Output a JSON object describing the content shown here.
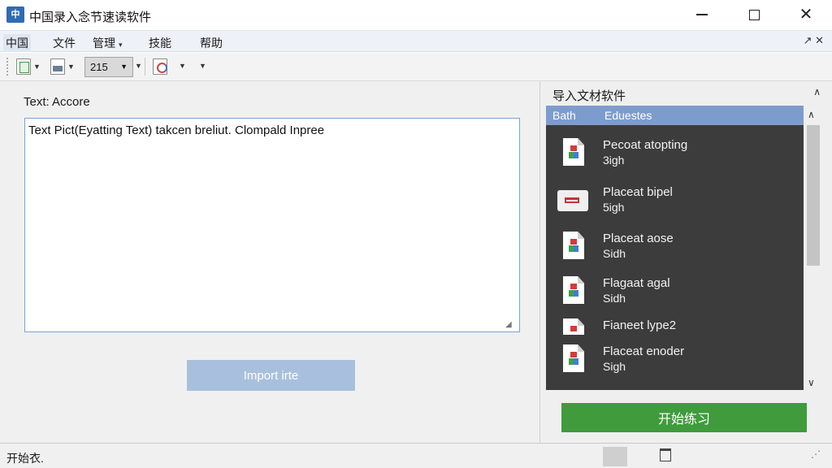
{
  "window": {
    "icon_text": "中",
    "title": "中国录入念节速读软件"
  },
  "menubar": {
    "items": [
      {
        "label": "中国"
      },
      {
        "label": "文件"
      },
      {
        "label": "管理",
        "caret": "▾"
      },
      {
        "label": "技能"
      },
      {
        "label": "帮助"
      }
    ],
    "right_symbols": "↗ ✕"
  },
  "toolbar": {
    "combo_value": "215"
  },
  "editor": {
    "label": "Text:  Accore",
    "content": "Text Pict(Eyatting Text) takcen breliut. Clompald Inpree",
    "import_button": "Import irte"
  },
  "right_panel": {
    "header": "导入文材软件",
    "columns": [
      "Bath",
      "Eduestes"
    ],
    "items": [
      {
        "title": "Pecoat atopting",
        "sub": "3igh",
        "icon": "document-icon"
      },
      {
        "title": "Placeat bipel",
        "sub": "5igh",
        "icon": "folder-icon"
      },
      {
        "title": "Placeat aose",
        "sub": "Sidh",
        "icon": "document-icon"
      },
      {
        "title": "Flagaat agal",
        "sub": "Sidh",
        "icon": "document-icon"
      },
      {
        "title": "Fianeet lype2",
        "sub": "",
        "icon": "document-icon"
      },
      {
        "title": "Flaceat enoder",
        "sub": "Sigh",
        "icon": "document-icon"
      }
    ],
    "start_button": "开始练习"
  },
  "statusbar": {
    "text": "开始衣."
  },
  "colors": {
    "accent_blue": "#7d9ccd",
    "import_button": "#a8c0dd",
    "start_green": "#3f9b3c",
    "list_bg": "#3c3c3c"
  }
}
